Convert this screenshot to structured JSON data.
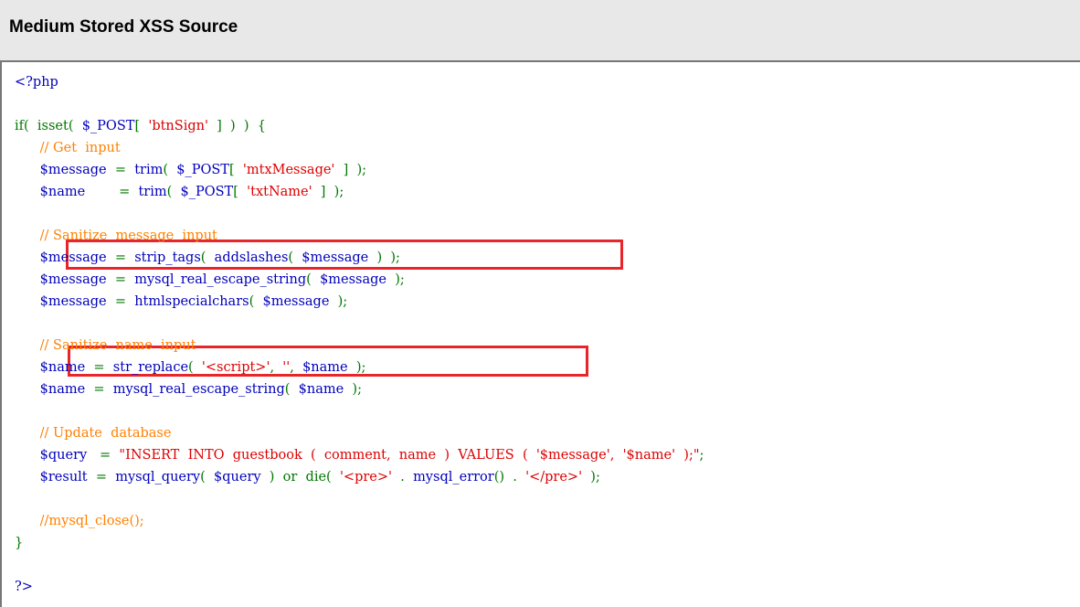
{
  "title": "Medium Stored XSS Source",
  "colors": {
    "default": "#0000bb",
    "keyword": "#007700",
    "comment": "#ff8000",
    "string": "#dd0000",
    "highlight_box": "#e8262a"
  },
  "code": {
    "lines": [
      [
        {
          "t": "<?php",
          "c": "default"
        }
      ],
      [],
      [
        {
          "t": "if(",
          "c": "keyword"
        },
        {
          "t": "  isset(",
          "c": "keyword"
        },
        {
          "t": "  $_POST",
          "c": "default"
        },
        {
          "t": "[",
          "c": "keyword"
        },
        {
          "t": "  'btnSign'",
          "c": "string"
        },
        {
          "t": "  ]  )  )  {",
          "c": "keyword"
        }
      ],
      [
        {
          "t": "      // Get  input",
          "c": "comment"
        }
      ],
      [
        {
          "t": "      $message",
          "c": "default"
        },
        {
          "t": "  =  ",
          "c": "keyword"
        },
        {
          "t": "trim",
          "c": "default"
        },
        {
          "t": "(  ",
          "c": "keyword"
        },
        {
          "t": "$_POST",
          "c": "default"
        },
        {
          "t": "[  ",
          "c": "keyword"
        },
        {
          "t": "'mtxMessage'",
          "c": "string"
        },
        {
          "t": "  ]  );",
          "c": "keyword"
        }
      ],
      [
        {
          "t": "      $name",
          "c": "default"
        },
        {
          "t": "        =  ",
          "c": "keyword"
        },
        {
          "t": "trim",
          "c": "default"
        },
        {
          "t": "(  ",
          "c": "keyword"
        },
        {
          "t": "$_POST",
          "c": "default"
        },
        {
          "t": "[  ",
          "c": "keyword"
        },
        {
          "t": "'txtName'",
          "c": "string"
        },
        {
          "t": "  ]  );",
          "c": "keyword"
        }
      ],
      [],
      [
        {
          "t": "      // Sanitize  message  input",
          "c": "comment"
        }
      ],
      [
        {
          "t": "      $message",
          "c": "default"
        },
        {
          "t": "  =  ",
          "c": "keyword"
        },
        {
          "t": "strip_tags",
          "c": "default"
        },
        {
          "t": "(  ",
          "c": "keyword"
        },
        {
          "t": "addslashes",
          "c": "default"
        },
        {
          "t": "(  ",
          "c": "keyword"
        },
        {
          "t": "$message",
          "c": "default"
        },
        {
          "t": "  )  );",
          "c": "keyword"
        }
      ],
      [
        {
          "t": "      $message",
          "c": "default"
        },
        {
          "t": "  =  ",
          "c": "keyword"
        },
        {
          "t": "mysql_real_escape_string",
          "c": "default"
        },
        {
          "t": "(  ",
          "c": "keyword"
        },
        {
          "t": "$message",
          "c": "default"
        },
        {
          "t": "  );",
          "c": "keyword"
        }
      ],
      [
        {
          "t": "      $message",
          "c": "default"
        },
        {
          "t": "  =  ",
          "c": "keyword"
        },
        {
          "t": "htmlspecialchars",
          "c": "default"
        },
        {
          "t": "(  ",
          "c": "keyword"
        },
        {
          "t": "$message",
          "c": "default"
        },
        {
          "t": "  );",
          "c": "keyword"
        }
      ],
      [],
      [
        {
          "t": "      // Sanitize  name  input",
          "c": "comment"
        }
      ],
      [
        {
          "t": "      $name",
          "c": "default"
        },
        {
          "t": "  =  ",
          "c": "keyword"
        },
        {
          "t": "str_replace",
          "c": "default"
        },
        {
          "t": "(  ",
          "c": "keyword"
        },
        {
          "t": "'<script>'",
          "c": "string"
        },
        {
          "t": ",  ",
          "c": "keyword"
        },
        {
          "t": "''",
          "c": "string"
        },
        {
          "t": ",  ",
          "c": "keyword"
        },
        {
          "t": "$name",
          "c": "default"
        },
        {
          "t": "  );",
          "c": "keyword"
        }
      ],
      [
        {
          "t": "      $name",
          "c": "default"
        },
        {
          "t": "  =  ",
          "c": "keyword"
        },
        {
          "t": "mysql_real_escape_string",
          "c": "default"
        },
        {
          "t": "(  ",
          "c": "keyword"
        },
        {
          "t": "$name",
          "c": "default"
        },
        {
          "t": "  );",
          "c": "keyword"
        }
      ],
      [],
      [
        {
          "t": "      // Update  database",
          "c": "comment"
        }
      ],
      [
        {
          "t": "      $query",
          "c": "default"
        },
        {
          "t": "   =  ",
          "c": "keyword"
        },
        {
          "t": "\"INSERT  INTO  guestbook  (  comment,  name  )  VALUES  (  '$message',  '$name'  );\"",
          "c": "string"
        },
        {
          "t": ";",
          "c": "keyword"
        }
      ],
      [
        {
          "t": "      $result",
          "c": "default"
        },
        {
          "t": "  =  ",
          "c": "keyword"
        },
        {
          "t": "mysql_query",
          "c": "default"
        },
        {
          "t": "(  ",
          "c": "keyword"
        },
        {
          "t": "$query",
          "c": "default"
        },
        {
          "t": "  )  or  die(  ",
          "c": "keyword"
        },
        {
          "t": "'<pre>'",
          "c": "string"
        },
        {
          "t": "  .  ",
          "c": "keyword"
        },
        {
          "t": "mysql_error",
          "c": "default"
        },
        {
          "t": "()  .  ",
          "c": "keyword"
        },
        {
          "t": "'</pre>'",
          "c": "string"
        },
        {
          "t": "  );",
          "c": "keyword"
        }
      ],
      [],
      [
        {
          "t": "      //mysql_close();",
          "c": "comment"
        }
      ],
      [
        {
          "t": "}",
          "c": "keyword"
        }
      ],
      [],
      [
        {
          "t": "?>",
          "c": "default"
        }
      ]
    ]
  }
}
